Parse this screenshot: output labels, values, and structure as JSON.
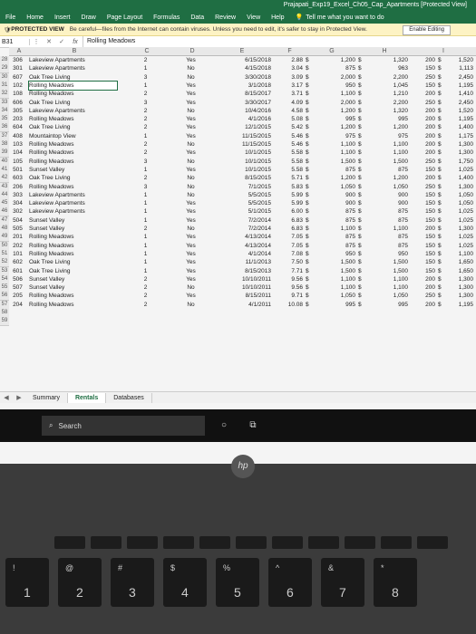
{
  "window": {
    "title": "Prajapati_Exp19_Excel_Ch05_Cap_Apartments [Protected View]"
  },
  "ribbon": {
    "tabs": [
      "File",
      "Home",
      "Insert",
      "Draw",
      "Page Layout",
      "Formulas",
      "Data",
      "Review",
      "View",
      "Help"
    ],
    "tell_me": "Tell me what you want to do"
  },
  "protected": {
    "label": "PROTECTED VIEW",
    "message": "Be careful—files from the Internet can contain viruses. Unless you need to edit, it's safer to stay in Protected View.",
    "button": "Enable Editing"
  },
  "formula_bar": {
    "namebox": "B31",
    "value": "Rolling Meadows"
  },
  "columns": [
    "A",
    "B",
    "C",
    "D",
    "E",
    "F",
    "G",
    "H",
    "I"
  ],
  "rows": [
    {
      "n": "28",
      "a": "306",
      "b": "Lakeview Apartments",
      "c": "2",
      "d": "Yes",
      "e": "6/15/2018",
      "f": "2.88",
      "g": "1,200",
      "h": "1,320",
      "i": "200",
      "j": "1,520"
    },
    {
      "n": "29",
      "a": "301",
      "b": "Lakeview Apartments",
      "c": "1",
      "d": "No",
      "e": "4/15/2018",
      "f": "3.04",
      "g": "875",
      "h": "963",
      "i": "150",
      "j": "1,113"
    },
    {
      "n": "30",
      "a": "607",
      "b": "Oak Tree Living",
      "c": "3",
      "d": "No",
      "e": "3/30/2018",
      "f": "3.09",
      "g": "2,000",
      "h": "2,200",
      "i": "250",
      "j": "2,450"
    },
    {
      "n": "31",
      "a": "102",
      "b": "Rolling Meadows",
      "c": "1",
      "d": "Yes",
      "e": "3/1/2018",
      "f": "3.17",
      "g": "950",
      "h": "1,045",
      "i": "150",
      "j": "1,195"
    },
    {
      "n": "32",
      "a": "108",
      "b": "Rolling Meadows",
      "c": "2",
      "d": "Yes",
      "e": "8/15/2017",
      "f": "3.71",
      "g": "1,100",
      "h": "1,210",
      "i": "200",
      "j": "1,410"
    },
    {
      "n": "33",
      "a": "606",
      "b": "Oak Tree Living",
      "c": "3",
      "d": "Yes",
      "e": "3/30/2017",
      "f": "4.09",
      "g": "2,000",
      "h": "2,200",
      "i": "250",
      "j": "2,450"
    },
    {
      "n": "34",
      "a": "305",
      "b": "Lakeview Apartments",
      "c": "2",
      "d": "No",
      "e": "10/4/2016",
      "f": "4.58",
      "g": "1,200",
      "h": "1,320",
      "i": "200",
      "j": "1,520"
    },
    {
      "n": "35",
      "a": "203",
      "b": "Rolling Meadows",
      "c": "2",
      "d": "Yes",
      "e": "4/1/2016",
      "f": "5.08",
      "g": "995",
      "h": "995",
      "i": "200",
      "j": "1,195"
    },
    {
      "n": "36",
      "a": "604",
      "b": "Oak Tree Living",
      "c": "2",
      "d": "Yes",
      "e": "12/1/2015",
      "f": "5.42",
      "g": "1,200",
      "h": "1,200",
      "i": "200",
      "j": "1,400"
    },
    {
      "n": "37",
      "a": "408",
      "b": "Mountaintop View",
      "c": "1",
      "d": "Yes",
      "e": "11/15/2015",
      "f": "5.46",
      "g": "975",
      "h": "975",
      "i": "200",
      "j": "1,175"
    },
    {
      "n": "38",
      "a": "103",
      "b": "Rolling Meadows",
      "c": "2",
      "d": "No",
      "e": "11/15/2015",
      "f": "5.46",
      "g": "1,100",
      "h": "1,100",
      "i": "200",
      "j": "1,300"
    },
    {
      "n": "39",
      "a": "104",
      "b": "Rolling Meadows",
      "c": "2",
      "d": "Yes",
      "e": "10/1/2015",
      "f": "5.58",
      "g": "1,100",
      "h": "1,100",
      "i": "200",
      "j": "1,300"
    },
    {
      "n": "40",
      "a": "105",
      "b": "Rolling Meadows",
      "c": "3",
      "d": "No",
      "e": "10/1/2015",
      "f": "5.58",
      "g": "1,500",
      "h": "1,500",
      "i": "250",
      "j": "1,750"
    },
    {
      "n": "41",
      "a": "501",
      "b": "Sunset Valley",
      "c": "1",
      "d": "Yes",
      "e": "10/1/2015",
      "f": "5.58",
      "g": "875",
      "h": "875",
      "i": "150",
      "j": "1,025"
    },
    {
      "n": "42",
      "a": "603",
      "b": "Oak Tree Living",
      "c": "2",
      "d": "No",
      "e": "8/15/2015",
      "f": "5.71",
      "g": "1,200",
      "h": "1,200",
      "i": "200",
      "j": "1,400"
    },
    {
      "n": "43",
      "a": "206",
      "b": "Rolling Meadows",
      "c": "3",
      "d": "No",
      "e": "7/1/2015",
      "f": "5.83",
      "g": "1,050",
      "h": "1,050",
      "i": "250",
      "j": "1,300"
    },
    {
      "n": "44",
      "a": "303",
      "b": "Lakeview Apartments",
      "c": "1",
      "d": "No",
      "e": "5/5/2015",
      "f": "5.99",
      "g": "900",
      "h": "900",
      "i": "150",
      "j": "1,050"
    },
    {
      "n": "45",
      "a": "304",
      "b": "Lakeview Apartments",
      "c": "1",
      "d": "Yes",
      "e": "5/5/2015",
      "f": "5.99",
      "g": "900",
      "h": "900",
      "i": "150",
      "j": "1,050"
    },
    {
      "n": "46",
      "a": "302",
      "b": "Lakeview Apartments",
      "c": "1",
      "d": "Yes",
      "e": "5/1/2015",
      "f": "6.00",
      "g": "875",
      "h": "875",
      "i": "150",
      "j": "1,025"
    },
    {
      "n": "47",
      "a": "504",
      "b": "Sunset Valley",
      "c": "1",
      "d": "Yes",
      "e": "7/2/2014",
      "f": "6.83",
      "g": "875",
      "h": "875",
      "i": "150",
      "j": "1,025"
    },
    {
      "n": "48",
      "a": "505",
      "b": "Sunset Valley",
      "c": "2",
      "d": "No",
      "e": "7/2/2014",
      "f": "6.83",
      "g": "1,100",
      "h": "1,100",
      "i": "200",
      "j": "1,300"
    },
    {
      "n": "49",
      "a": "201",
      "b": "Rolling Meadows",
      "c": "1",
      "d": "Yes",
      "e": "4/13/2014",
      "f": "7.05",
      "g": "875",
      "h": "875",
      "i": "150",
      "j": "1,025"
    },
    {
      "n": "50",
      "a": "202",
      "b": "Rolling Meadows",
      "c": "1",
      "d": "Yes",
      "e": "4/13/2014",
      "f": "7.05",
      "g": "875",
      "h": "875",
      "i": "150",
      "j": "1,025"
    },
    {
      "n": "51",
      "a": "101",
      "b": "Rolling Meadows",
      "c": "1",
      "d": "Yes",
      "e": "4/1/2014",
      "f": "7.08",
      "g": "950",
      "h": "950",
      "i": "150",
      "j": "1,100"
    },
    {
      "n": "52",
      "a": "602",
      "b": "Oak Tree Living",
      "c": "1",
      "d": "Yes",
      "e": "11/1/2013",
      "f": "7.50",
      "g": "1,500",
      "h": "1,500",
      "i": "150",
      "j": "1,650"
    },
    {
      "n": "53",
      "a": "601",
      "b": "Oak Tree Living",
      "c": "1",
      "d": "Yes",
      "e": "8/15/2013",
      "f": "7.71",
      "g": "1,500",
      "h": "1,500",
      "i": "150",
      "j": "1,650"
    },
    {
      "n": "54",
      "a": "506",
      "b": "Sunset Valley",
      "c": "2",
      "d": "Yes",
      "e": "10/10/2011",
      "f": "9.56",
      "g": "1,100",
      "h": "1,100",
      "i": "200",
      "j": "1,300"
    },
    {
      "n": "55",
      "a": "507",
      "b": "Sunset Valley",
      "c": "2",
      "d": "No",
      "e": "10/10/2011",
      "f": "9.56",
      "g": "1,100",
      "h": "1,100",
      "i": "200",
      "j": "1,300"
    },
    {
      "n": "56",
      "a": "205",
      "b": "Rolling Meadows",
      "c": "2",
      "d": "Yes",
      "e": "8/15/2011",
      "f": "9.71",
      "g": "1,050",
      "h": "1,050",
      "i": "250",
      "j": "1,300"
    },
    {
      "n": "57",
      "a": "204",
      "b": "Rolling Meadows",
      "c": "2",
      "d": "No",
      "e": "4/1/2011",
      "f": "10.08",
      "g": "995",
      "h": "995",
      "i": "200",
      "j": "1,195"
    },
    {
      "n": "58"
    },
    {
      "n": "59"
    }
  ],
  "dollar": "$",
  "sheets": [
    "Summary",
    "Rentals",
    "Databases"
  ],
  "taskbar": {
    "search": "Search"
  },
  "laptop": {
    "brand": "hp",
    "keys": [
      {
        "sym": "!",
        "num": "1"
      },
      {
        "sym": "@",
        "num": "2"
      },
      {
        "sym": "#",
        "num": "3"
      },
      {
        "sym": "$",
        "num": "4"
      },
      {
        "sym": "%",
        "num": "5"
      },
      {
        "sym": "^",
        "num": "6"
      },
      {
        "sym": "&",
        "num": "7"
      },
      {
        "sym": "*",
        "num": "8"
      }
    ]
  }
}
